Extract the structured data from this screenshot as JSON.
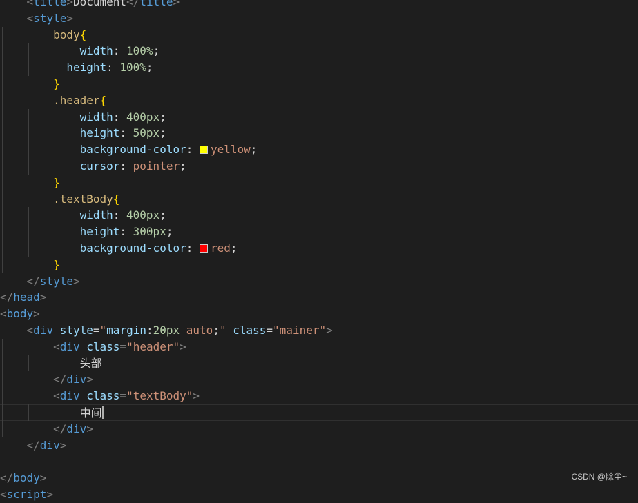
{
  "editor": {
    "lines": [
      {
        "indent": 1,
        "tokens": [
          {
            "c": "t-punc",
            "t": "<"
          },
          {
            "c": "t-tag",
            "t": "title"
          },
          {
            "c": "t-punc",
            "t": ">"
          },
          {
            "c": "t-text",
            "t": "Document"
          },
          {
            "c": "t-punc",
            "t": "</"
          },
          {
            "c": "t-tag",
            "t": "title"
          },
          {
            "c": "t-punc",
            "t": ">"
          }
        ]
      },
      {
        "indent": 1,
        "tokens": [
          {
            "c": "t-punc",
            "t": "<"
          },
          {
            "c": "t-tag",
            "t": "style"
          },
          {
            "c": "t-punc",
            "t": ">"
          }
        ]
      },
      {
        "indent": 2,
        "tokens": [
          {
            "c": "t-sel",
            "t": "body"
          },
          {
            "c": "t-brace",
            "t": "{"
          }
        ]
      },
      {
        "indent": 3,
        "tokens": [
          {
            "c": "t-prop",
            "t": "width"
          },
          {
            "c": "t-text",
            "t": ": "
          },
          {
            "c": "t-num",
            "t": "100%"
          },
          {
            "c": "t-text",
            "t": ";"
          }
        ]
      },
      {
        "indent": 2,
        "lead": "  ",
        "tokens": [
          {
            "c": "t-prop",
            "t": "height"
          },
          {
            "c": "t-text",
            "t": ": "
          },
          {
            "c": "t-num",
            "t": "100%"
          },
          {
            "c": "t-text",
            "t": ";"
          }
        ]
      },
      {
        "indent": 2,
        "tokens": [
          {
            "c": "t-brace",
            "t": "}"
          }
        ]
      },
      {
        "indent": 2,
        "tokens": [
          {
            "c": "t-sel",
            "t": ".header"
          },
          {
            "c": "t-brace",
            "t": "{"
          }
        ]
      },
      {
        "indent": 3,
        "tokens": [
          {
            "c": "t-prop",
            "t": "width"
          },
          {
            "c": "t-text",
            "t": ": "
          },
          {
            "c": "t-num",
            "t": "400px"
          },
          {
            "c": "t-text",
            "t": ";"
          }
        ]
      },
      {
        "indent": 3,
        "tokens": [
          {
            "c": "t-prop",
            "t": "height"
          },
          {
            "c": "t-text",
            "t": ": "
          },
          {
            "c": "t-num",
            "t": "50px"
          },
          {
            "c": "t-text",
            "t": ";"
          }
        ]
      },
      {
        "indent": 3,
        "tokens": [
          {
            "c": "t-prop",
            "t": "background-color"
          },
          {
            "c": "t-text",
            "t": ": "
          },
          {
            "swatch": "#ffff00"
          },
          {
            "c": "t-val",
            "t": "yellow"
          },
          {
            "c": "t-text",
            "t": ";"
          }
        ]
      },
      {
        "indent": 3,
        "tokens": [
          {
            "c": "t-prop",
            "t": "cursor"
          },
          {
            "c": "t-text",
            "t": ": "
          },
          {
            "c": "t-val",
            "t": "pointer"
          },
          {
            "c": "t-text",
            "t": ";"
          }
        ]
      },
      {
        "indent": 2,
        "tokens": [
          {
            "c": "t-brace",
            "t": "}"
          }
        ]
      },
      {
        "indent": 2,
        "tokens": [
          {
            "c": "t-sel",
            "t": ".textBody"
          },
          {
            "c": "t-brace",
            "t": "{"
          }
        ]
      },
      {
        "indent": 3,
        "tokens": [
          {
            "c": "t-prop",
            "t": "width"
          },
          {
            "c": "t-text",
            "t": ": "
          },
          {
            "c": "t-num",
            "t": "400px"
          },
          {
            "c": "t-text",
            "t": ";"
          }
        ]
      },
      {
        "indent": 3,
        "tokens": [
          {
            "c": "t-prop",
            "t": "height"
          },
          {
            "c": "t-text",
            "t": ": "
          },
          {
            "c": "t-num",
            "t": "300px"
          },
          {
            "c": "t-text",
            "t": ";"
          }
        ]
      },
      {
        "indent": 3,
        "tokens": [
          {
            "c": "t-prop",
            "t": "background-color"
          },
          {
            "c": "t-text",
            "t": ": "
          },
          {
            "swatch": "#ff0000"
          },
          {
            "c": "t-val",
            "t": "red"
          },
          {
            "c": "t-text",
            "t": ";"
          }
        ]
      },
      {
        "indent": 2,
        "tokens": [
          {
            "c": "t-brace",
            "t": "}"
          }
        ]
      },
      {
        "indent": 1,
        "tokens": [
          {
            "c": "t-punc",
            "t": "</"
          },
          {
            "c": "t-tag",
            "t": "style"
          },
          {
            "c": "t-punc",
            "t": ">"
          }
        ]
      },
      {
        "indent": 0,
        "tokens": [
          {
            "c": "t-punc",
            "t": "</"
          },
          {
            "c": "t-tag",
            "t": "head"
          },
          {
            "c": "t-punc",
            "t": ">"
          }
        ]
      },
      {
        "indent": 0,
        "tokens": [
          {
            "c": "t-punc",
            "t": "<"
          },
          {
            "c": "t-tag",
            "t": "body"
          },
          {
            "c": "t-punc",
            "t": ">"
          }
        ]
      },
      {
        "indent": 1,
        "tokens": [
          {
            "c": "t-punc",
            "t": "<"
          },
          {
            "c": "t-tag",
            "t": "div"
          },
          {
            "c": "t-text",
            "t": " "
          },
          {
            "c": "t-attr",
            "t": "style"
          },
          {
            "c": "t-text",
            "t": "="
          },
          {
            "c": "t-str",
            "t": "\""
          },
          {
            "c": "t-prop",
            "t": "margin"
          },
          {
            "c": "t-text",
            "t": ":"
          },
          {
            "c": "t-num",
            "t": "20px"
          },
          {
            "c": "t-text",
            "t": " "
          },
          {
            "c": "t-val",
            "t": "auto"
          },
          {
            "c": "t-text",
            "t": ";"
          },
          {
            "c": "t-str",
            "t": "\""
          },
          {
            "c": "t-text",
            "t": " "
          },
          {
            "c": "t-attr",
            "t": "class"
          },
          {
            "c": "t-text",
            "t": "="
          },
          {
            "c": "t-str",
            "t": "\"mainer\""
          },
          {
            "c": "t-punc",
            "t": ">"
          }
        ]
      },
      {
        "indent": 2,
        "tokens": [
          {
            "c": "t-punc",
            "t": "<"
          },
          {
            "c": "t-tag",
            "t": "div"
          },
          {
            "c": "t-text",
            "t": " "
          },
          {
            "c": "t-attr",
            "t": "class"
          },
          {
            "c": "t-text",
            "t": "="
          },
          {
            "c": "t-str",
            "t": "\"header\""
          },
          {
            "c": "t-punc",
            "t": ">"
          }
        ]
      },
      {
        "indent": 3,
        "tokens": [
          {
            "c": "t-text",
            "t": "头部"
          }
        ]
      },
      {
        "indent": 2,
        "tokens": [
          {
            "c": "t-punc",
            "t": "</"
          },
          {
            "c": "t-tag",
            "t": "div"
          },
          {
            "c": "t-punc",
            "t": ">"
          }
        ]
      },
      {
        "indent": 2,
        "tokens": [
          {
            "c": "t-punc",
            "t": "<"
          },
          {
            "c": "t-tag",
            "t": "div"
          },
          {
            "c": "t-text",
            "t": " "
          },
          {
            "c": "t-attr",
            "t": "class"
          },
          {
            "c": "t-text",
            "t": "="
          },
          {
            "c": "t-str",
            "t": "\"textBody\""
          },
          {
            "c": "t-punc",
            "t": ">"
          }
        ]
      },
      {
        "indent": 3,
        "current": true,
        "tokens": [
          {
            "c": "t-text",
            "t": "中间"
          },
          {
            "cursor": true
          }
        ]
      },
      {
        "indent": 2,
        "tokens": [
          {
            "c": "t-punc",
            "t": "</"
          },
          {
            "c": "t-tag",
            "t": "div"
          },
          {
            "c": "t-punc",
            "t": ">"
          }
        ]
      },
      {
        "indent": 1,
        "tokens": [
          {
            "c": "t-punc",
            "t": "</"
          },
          {
            "c": "t-tag",
            "t": "div"
          },
          {
            "c": "t-punc",
            "t": ">"
          }
        ]
      },
      {
        "indent": 0,
        "tokens": []
      },
      {
        "indent": 0,
        "tokens": [
          {
            "c": "t-punc",
            "t": "</"
          },
          {
            "c": "t-tag",
            "t": "body"
          },
          {
            "c": "t-punc",
            "t": ">"
          }
        ]
      },
      {
        "indent": 0,
        "tokens": [
          {
            "c": "t-punc",
            "t": "<"
          },
          {
            "c": "t-tag",
            "t": "script"
          },
          {
            "c": "t-punc",
            "t": ">"
          }
        ]
      }
    ]
  },
  "watermark": "CSDN @除尘~"
}
